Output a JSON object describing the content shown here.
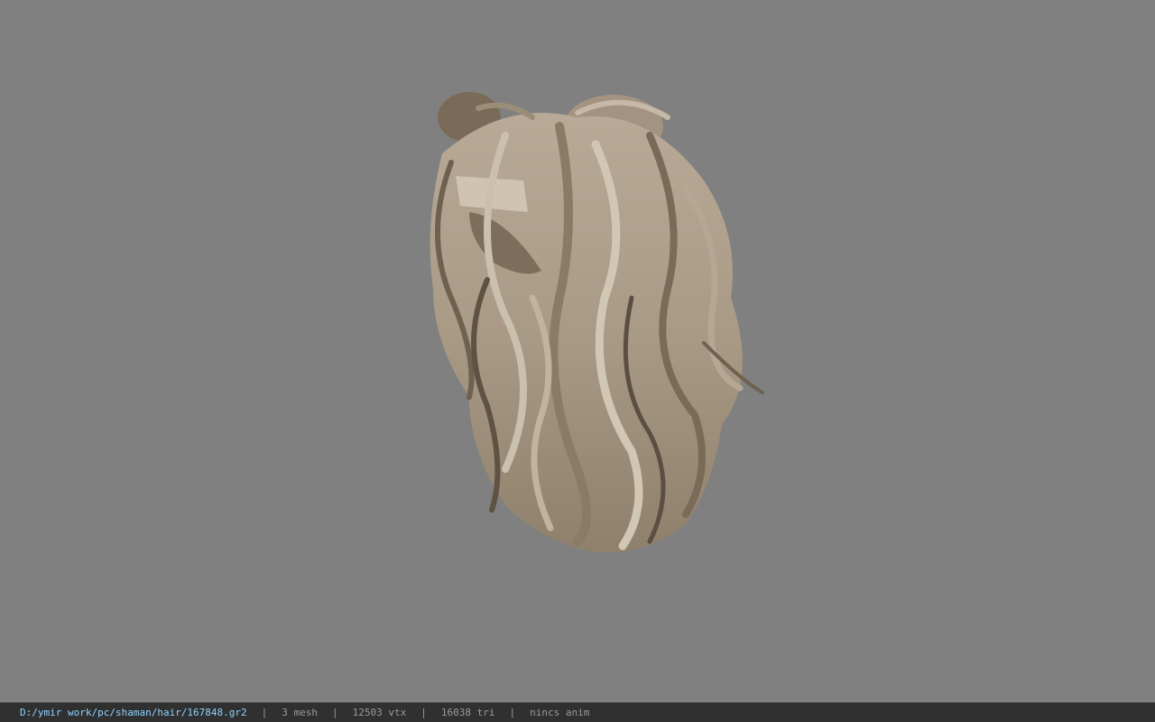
{
  "viewport": {
    "background": "#808080",
    "model": {
      "name": "hair-model",
      "colors": {
        "light": "#c9bcaa",
        "mid": "#a99a86",
        "dark": "#6f6150",
        "shadow": "#4f4538"
      }
    }
  },
  "statusbar": {
    "file_path": "D:/ymir work/pc/shaman/hair/167848.gr2",
    "separator": "|",
    "mesh_count": "3 mesh",
    "vertex_count": "12503 vtx",
    "triangle_count": "16038 tri",
    "anim_status": "nincs anim"
  }
}
